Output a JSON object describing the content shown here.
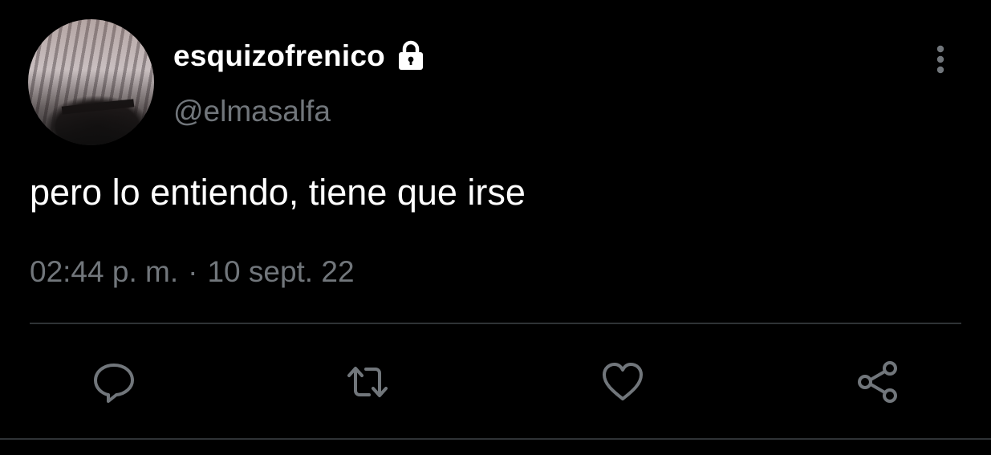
{
  "user": {
    "display_name": "esquizofrenico",
    "handle": "@elmasalfa",
    "protected_icon": "lock-icon",
    "avatar": "profile-photo"
  },
  "tweet": {
    "text": "pero lo entiendo, tiene que irse",
    "time": "02:44 p. m.",
    "separator": "·",
    "date": "10 sept. 22"
  },
  "actions": {
    "reply_icon": "speech-bubble-icon",
    "retweet_icon": "retweet-icon",
    "like_icon": "heart-icon",
    "share_icon": "share-icon"
  },
  "menu": {
    "more_icon": "vertical-dots-icon"
  },
  "colors": {
    "background": "#000000",
    "primary_text": "#ffffff",
    "secondary_text": "#71767b",
    "divider": "#2f3336"
  }
}
